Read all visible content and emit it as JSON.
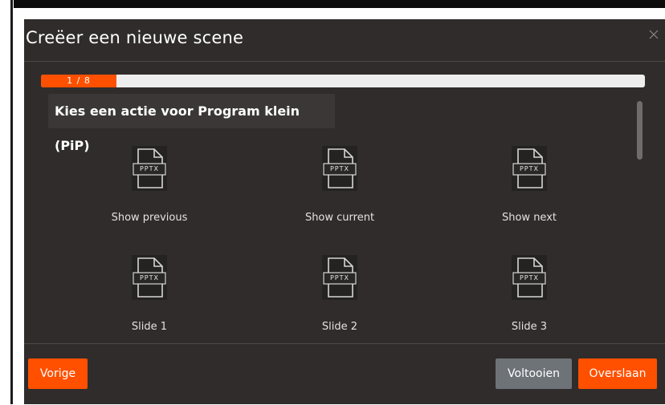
{
  "dialog": {
    "title": "Creëer een nieuwe scene",
    "close_icon": "close-icon"
  },
  "progress": {
    "label": "1 / 8",
    "current": 1,
    "total": 8,
    "fraction": 0.125,
    "fill_color": "#ff5000"
  },
  "prompt": {
    "text": "Kies een actie voor Program klein (PiP)"
  },
  "actions": [
    {
      "label": "Show previous",
      "icon": "pptx-file-icon",
      "badge": "PPTX"
    },
    {
      "label": "Show current",
      "icon": "pptx-file-icon",
      "badge": "PPTX"
    },
    {
      "label": "Show next",
      "icon": "pptx-file-icon",
      "badge": "PPTX"
    },
    {
      "label": "Slide 1",
      "icon": "pptx-file-icon",
      "badge": "PPTX"
    },
    {
      "label": "Slide 2",
      "icon": "pptx-file-icon",
      "badge": "PPTX"
    },
    {
      "label": "Slide 3",
      "icon": "pptx-file-icon",
      "badge": "PPTX"
    }
  ],
  "footer": {
    "previous_label": "Vorige",
    "finish_label": "Voltooien",
    "skip_label": "Overslaan"
  },
  "colors": {
    "accent": "#ff5000",
    "dialog_bg": "#2f2c2b",
    "secondary_button": "#6e7378"
  }
}
